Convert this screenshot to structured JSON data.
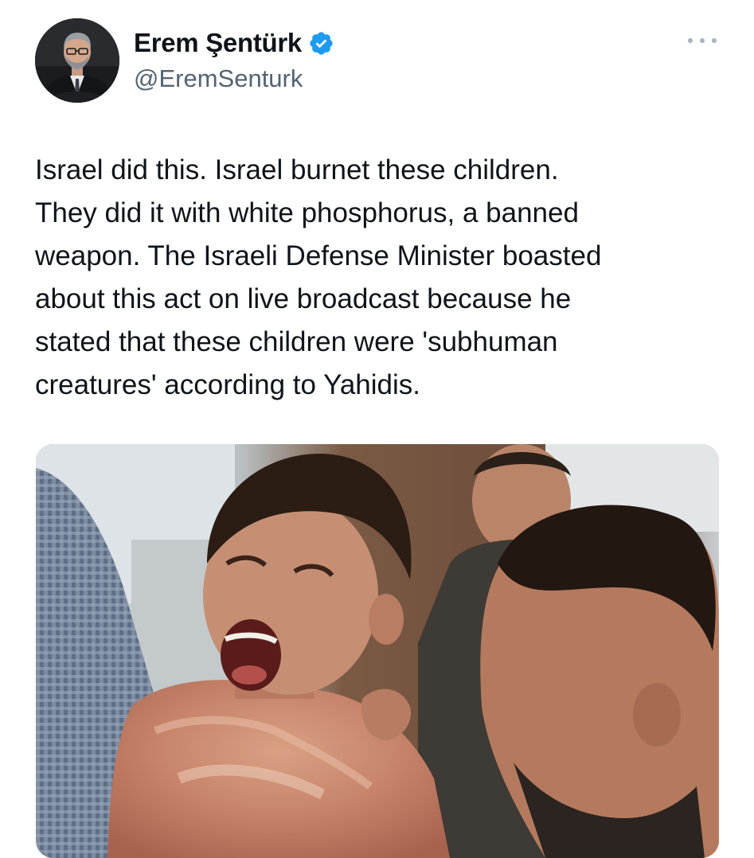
{
  "tweet": {
    "author": {
      "display_name": "Erem Şentürk",
      "handle": "@EremSenturk",
      "verified": true,
      "verified_color": "#1d9bf0"
    },
    "more_icon": "more-horizontal-icon",
    "text": "Israel did this. Israel burnet these children.\nThey did it with white phosphorus, a banned\nweapon. The Israeli Defense Minister boasted\nabout this act on live broadcast because he\nstated that these children were 'subhuman\ncreatures' according to Yahidis.",
    "media": {
      "type": "photo"
    }
  }
}
